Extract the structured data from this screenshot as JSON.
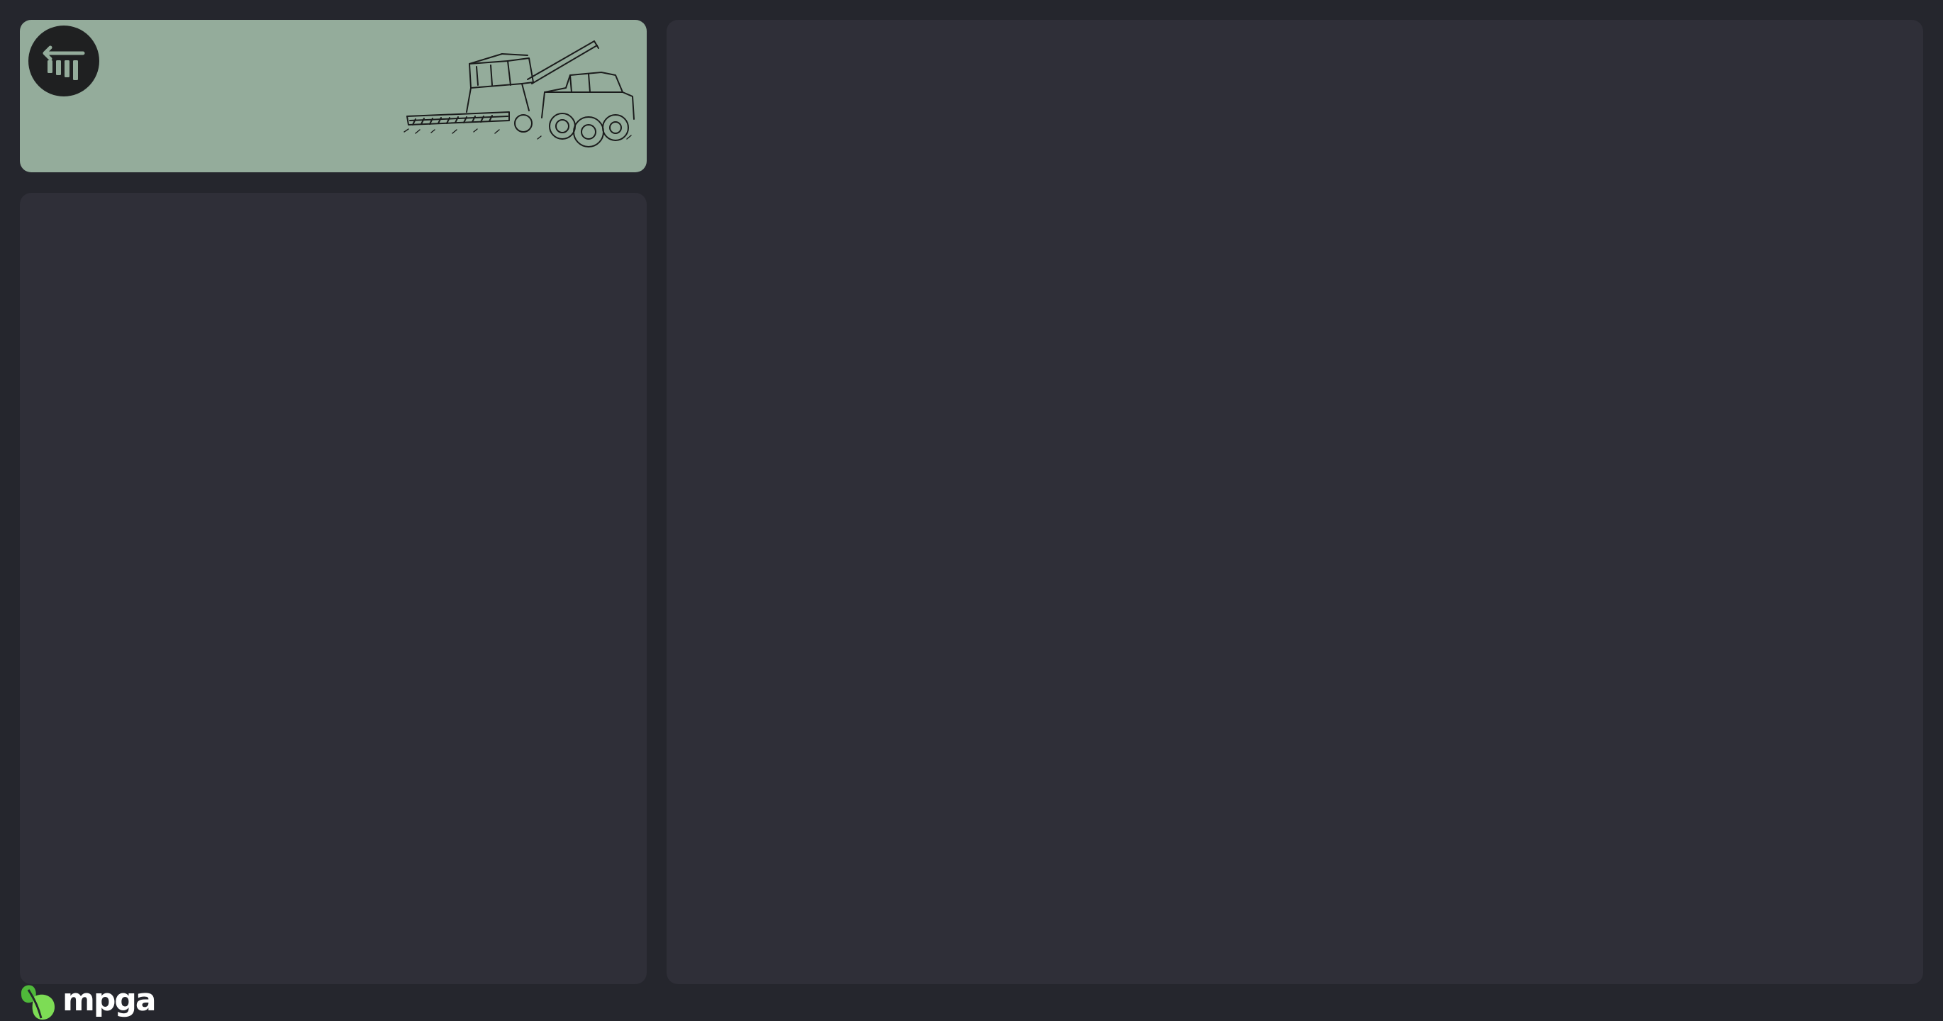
{
  "header": {
    "back_icon": "back-arrow-stats-icon",
    "illustration": "combine-harvester-and-tractor"
  },
  "brand": {
    "name": "mpga",
    "mark_icon": "leaf-logo-icon",
    "accent_color": "#6bd14a"
  },
  "colors": {
    "background": "#25262d",
    "panel": "#2f2f38",
    "header_card": "#94ac9b"
  }
}
